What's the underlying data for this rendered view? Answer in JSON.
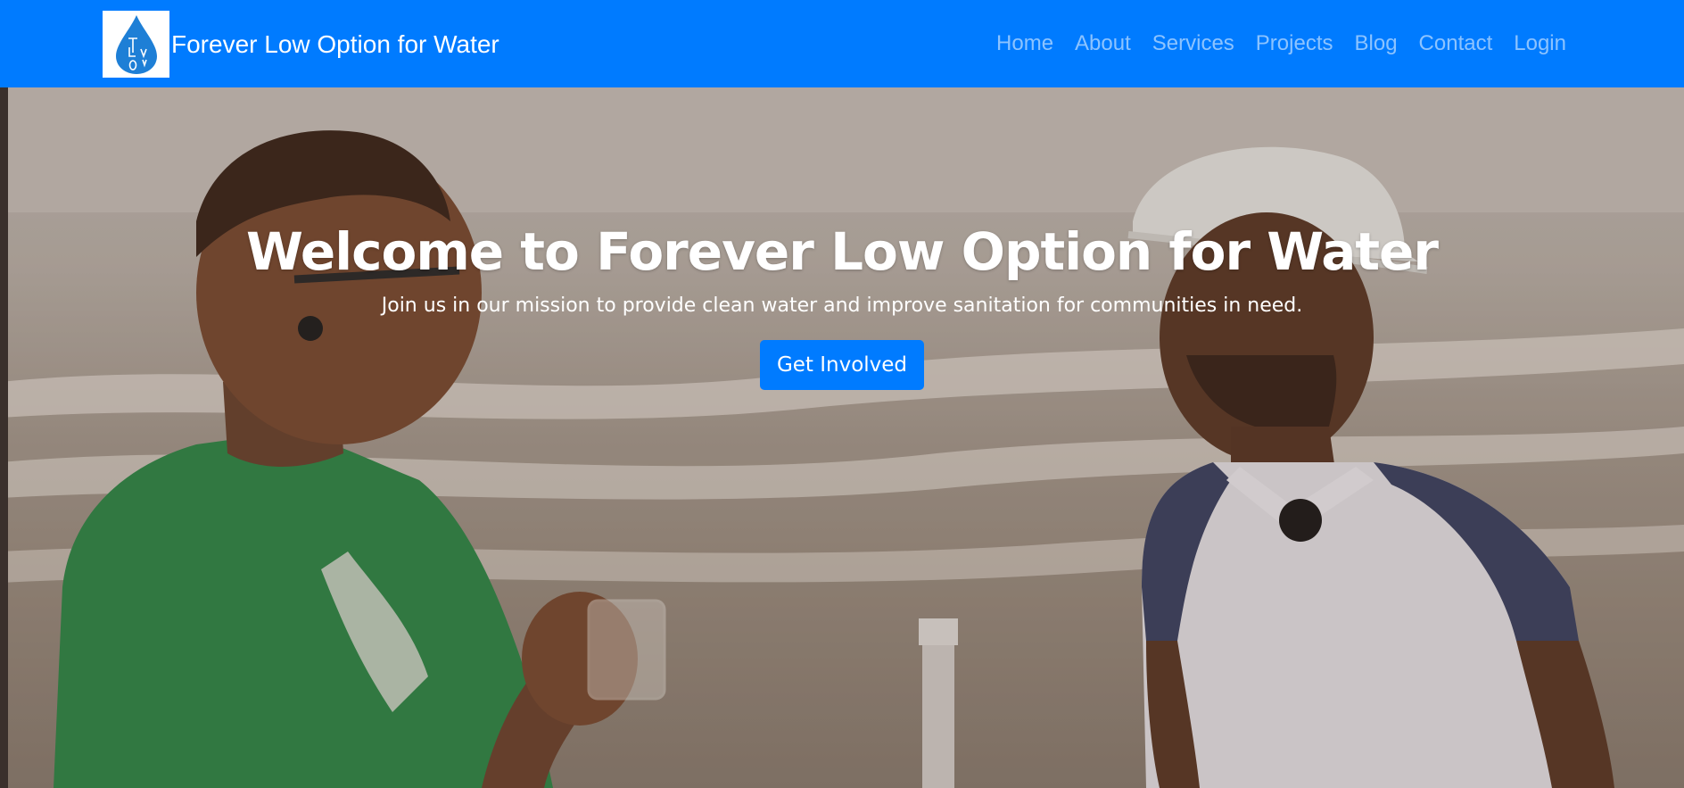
{
  "brand": {
    "name": "Forever Low Option for Water",
    "logo_icon": "water-drop-icon",
    "logo_letters": "FLOW"
  },
  "nav": {
    "items": [
      {
        "label": "Home"
      },
      {
        "label": "About"
      },
      {
        "label": "Services"
      },
      {
        "label": "Projects"
      },
      {
        "label": "Blog"
      },
      {
        "label": "Contact"
      },
      {
        "label": "Login"
      }
    ]
  },
  "hero": {
    "title": "Welcome to Forever Low Option for Water",
    "subtitle": "Join us in our mission to provide clean water and improve sanitation for communities in need.",
    "cta_label": "Get Involved"
  },
  "colors": {
    "primary": "#007bff",
    "nav_link": "rgba(255,255,255,0.55)",
    "text_light": "#ffffff"
  }
}
